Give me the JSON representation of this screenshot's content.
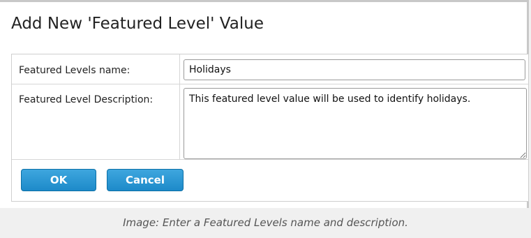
{
  "dialog": {
    "title": "Add New 'Featured Level' Value"
  },
  "form": {
    "name_label": "Featured Levels name:",
    "name_value": "Holidays",
    "description_label": "Featured Level Description:",
    "description_value": "This featured level value will be used to identify holidays."
  },
  "buttons": {
    "ok_label": "OK",
    "cancel_label": "Cancel"
  },
  "caption": "Image: Enter a Featured Levels name and description.",
  "colors": {
    "button_blue": "#1d8ac9",
    "border_gray": "#cfcfcf"
  }
}
